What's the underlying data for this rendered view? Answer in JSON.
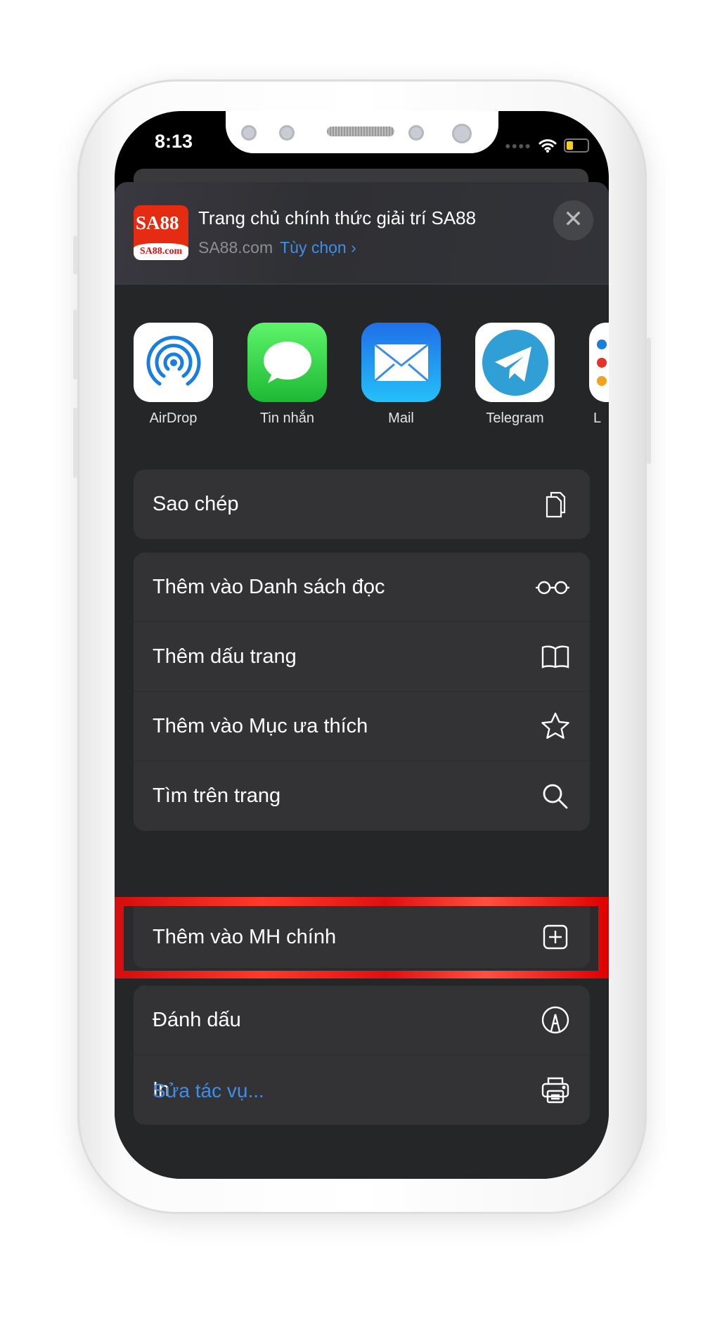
{
  "status": {
    "time": "8:13"
  },
  "share_header": {
    "title": "Trang chủ chính thức giải trí SA88",
    "domain": "SA88.com",
    "options_label": "Tùy chọn",
    "logo_text": "SA88",
    "logo_sub": "SA88.com",
    "close_icon": "close-icon"
  },
  "apps": [
    {
      "label": "AirDrop",
      "icon": "airdrop-icon"
    },
    {
      "label": "Tin nhắn",
      "icon": "messages-icon"
    },
    {
      "label": "Mail",
      "icon": "mail-icon"
    },
    {
      "label": "Telegram",
      "icon": "telegram-icon"
    },
    {
      "label": "L",
      "icon": "reminders-icon"
    }
  ],
  "actions": {
    "copy": {
      "label": "Sao chép",
      "icon": "copy-icon"
    },
    "reading_list": {
      "label": "Thêm vào Danh sách đọc",
      "icon": "glasses-icon"
    },
    "bookmark": {
      "label": "Thêm dấu trang",
      "icon": "book-icon"
    },
    "favorites": {
      "label": "Thêm vào Mục ưa thích",
      "icon": "star-icon"
    },
    "find": {
      "label": "Tìm trên trang",
      "icon": "search-icon"
    },
    "home_screen": {
      "label": "Thêm vào MH chính",
      "icon": "add-square-icon",
      "highlighted": true
    },
    "markup": {
      "label": "Đánh dấu",
      "icon": "markup-icon"
    },
    "print": {
      "label": "In",
      "icon": "printer-icon"
    }
  },
  "edit_actions": "Sửa tác vụ...",
  "colors": {
    "accent": "#3f8ee8",
    "highlight": "#e51212",
    "sheet": "#252628"
  }
}
